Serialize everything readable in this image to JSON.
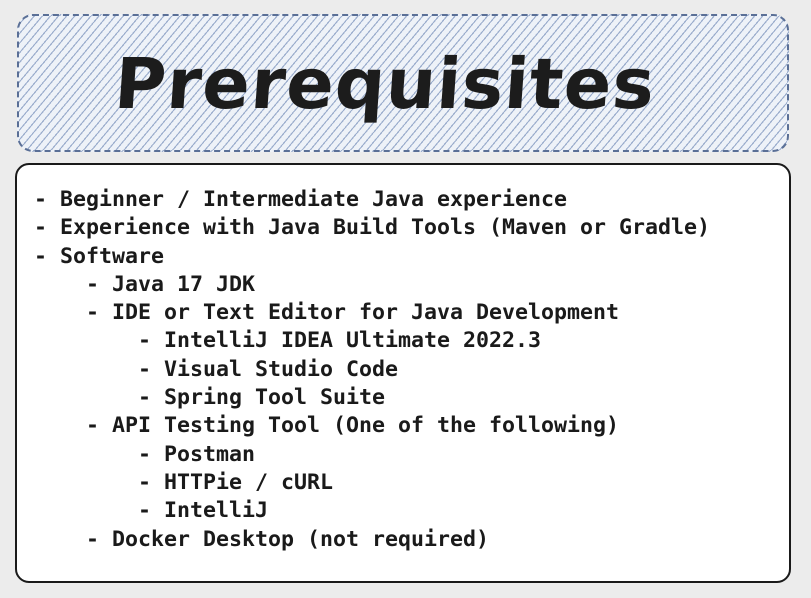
{
  "title": "Prerequisites",
  "items": [
    {
      "level": 0,
      "text": "Beginner / Intermediate Java experience"
    },
    {
      "level": 0,
      "text": "Experience with Java Build Tools (Maven or Gradle)"
    },
    {
      "level": 0,
      "text": "Software"
    },
    {
      "level": 1,
      "text": "Java 17 JDK"
    },
    {
      "level": 1,
      "text": "IDE or Text Editor for Java Development"
    },
    {
      "level": 2,
      "text": "IntelliJ IDEA Ultimate 2022.3"
    },
    {
      "level": 2,
      "text": "Visual Studio Code"
    },
    {
      "level": 2,
      "text": "Spring Tool Suite"
    },
    {
      "level": 1,
      "text": "API Testing Tool (One of the following)"
    },
    {
      "level": 2,
      "text": "Postman"
    },
    {
      "level": 2,
      "text": "HTTPie / cURL"
    },
    {
      "level": 2,
      "text": "IntelliJ"
    },
    {
      "level": 1,
      "text": "Docker Desktop (not required)"
    }
  ]
}
